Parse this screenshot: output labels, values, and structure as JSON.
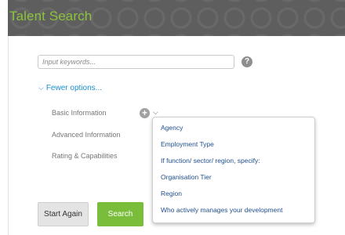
{
  "header": {
    "title": "Talent Search"
  },
  "search": {
    "placeholder": "Input keywords...",
    "value": ""
  },
  "toggle": {
    "label": "Fewer options..."
  },
  "options": {
    "basic": "Basic Information",
    "advanced": "Advanced Information",
    "rating": "Rating & Capabilities"
  },
  "dropdown": {
    "items": [
      "Agency",
      "Employment Type",
      "If function/ sector/ region, specify:",
      "Organisation Tier",
      "Region",
      "Who actively manages your development"
    ]
  },
  "buttons": {
    "start_again": "Start Again",
    "search": "Search"
  },
  "colors": {
    "accent_green": "#79bd3a",
    "title_green": "#8cc43c",
    "link_blue": "#1a8fcf",
    "dropdown_text": "#1f4f8f",
    "header_bg": "#5e5e5e"
  },
  "icons": {
    "help": "help-icon",
    "add": "add-icon",
    "chevron": "chevron-down-icon"
  }
}
